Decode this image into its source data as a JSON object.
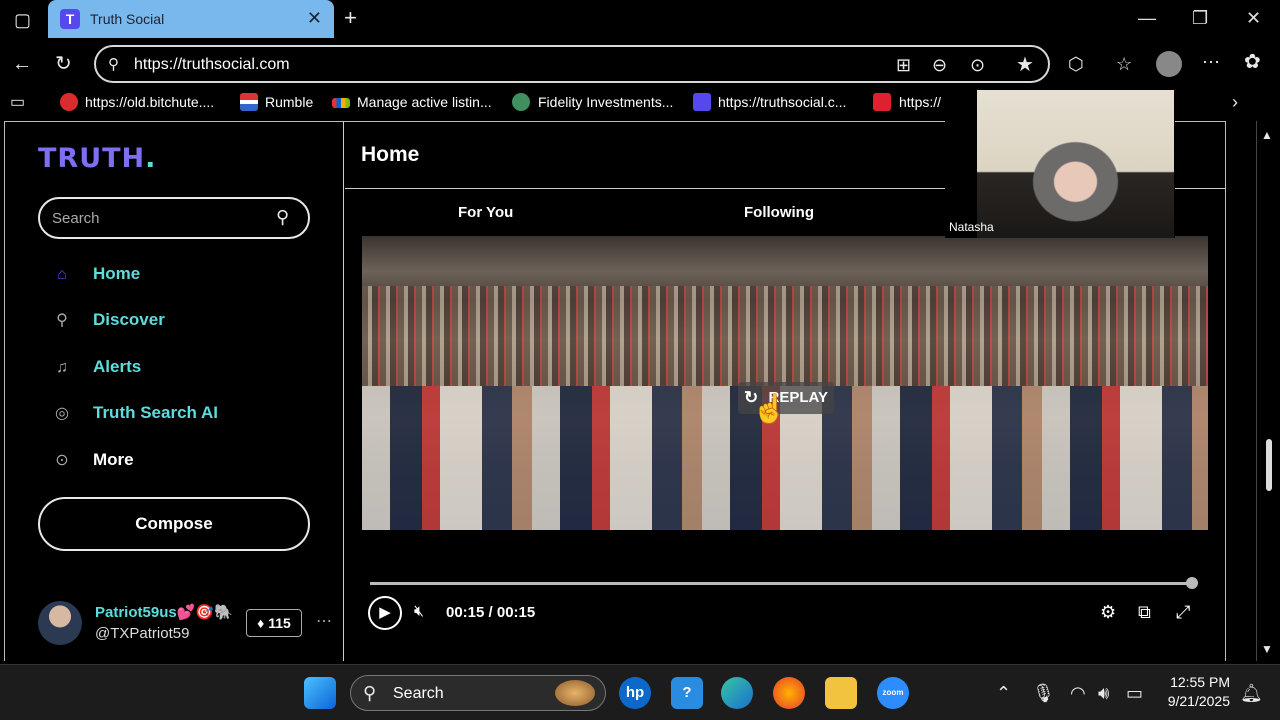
{
  "browser": {
    "tab_title": "Truth Social",
    "tab_close": "✕",
    "new_tab": "+",
    "url": "https://truthsocial.com",
    "window_controls": {
      "minimize": "—",
      "restore": "❐",
      "close": "✕"
    }
  },
  "bookmarks": [
    {
      "label": "https://old.bitchute....",
      "icon": "bitchute-icon",
      "color": "#d92d2d"
    },
    {
      "label": "Rumble",
      "icon": "flag-icon",
      "color": "#3c78d8"
    },
    {
      "label": "Manage active listin...",
      "icon": "ebay-icon",
      "color": "#e5b80b"
    },
    {
      "label": "Fidelity Investments...",
      "icon": "fidelity-icon",
      "color": "#3f8f5f"
    },
    {
      "label": "https://truthsocial.c...",
      "icon": "truth-icon",
      "color": "#5448ee"
    },
    {
      "label": "https://",
      "icon": "gettr-icon",
      "color": "#e01f2f"
    }
  ],
  "sidebar": {
    "logo": "TRUTH",
    "logo_dot": ".",
    "search_placeholder": "Search",
    "nav": [
      {
        "label": "Home",
        "icon": "home-icon"
      },
      {
        "label": "Discover",
        "icon": "search-icon"
      },
      {
        "label": "Alerts",
        "icon": "bell-icon"
      },
      {
        "label": "Truth Search AI",
        "icon": "ai-icon"
      },
      {
        "label": "More",
        "icon": "more-icon"
      }
    ],
    "compose_label": "Compose",
    "profile": {
      "display_name": "Patriot59us💕🎯🐘",
      "handle": "@TXPatriot59",
      "badge_count": "115"
    }
  },
  "main": {
    "title": "Home",
    "tabs": [
      "For You",
      "Following"
    ]
  },
  "video": {
    "replay_label": "REPLAY",
    "time": "00:15 / 00:15",
    "progress": 1.0
  },
  "zoom": {
    "participant_name": "Natasha"
  },
  "taskbar": {
    "search_label": "Search",
    "time": "12:55 PM",
    "date": "9/21/2025"
  }
}
